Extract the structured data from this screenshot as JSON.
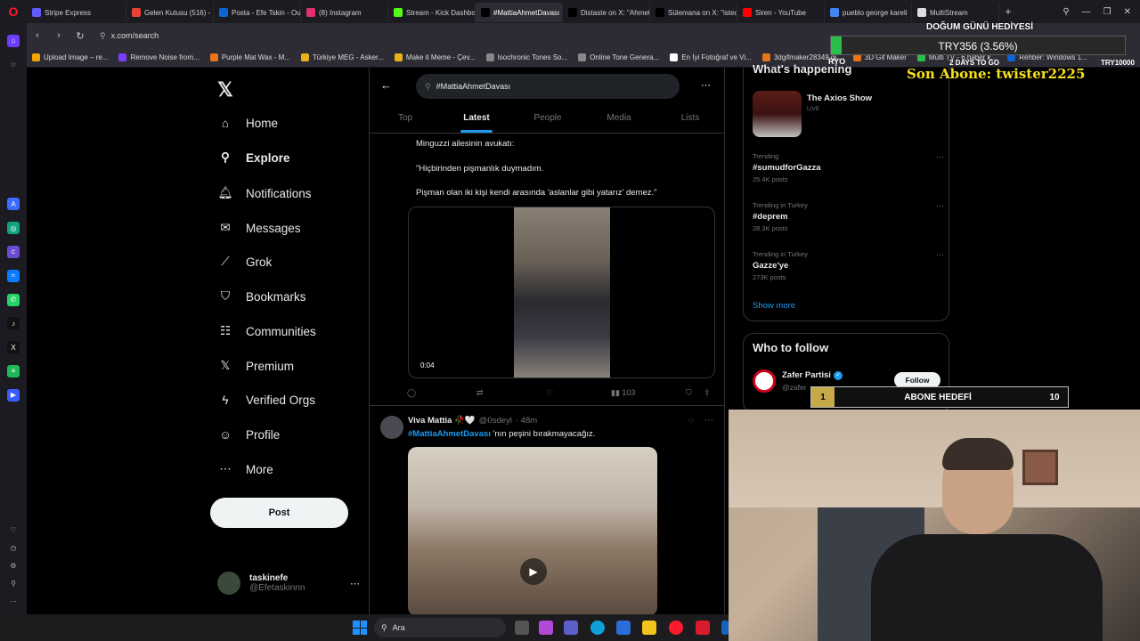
{
  "browser": {
    "tabs": [
      {
        "label": "Stripe Express",
        "color": "#635bff",
        "active": false
      },
      {
        "label": "Gelen Kutusu (516) - ",
        "color": "#ea4335",
        "active": false
      },
      {
        "label": "Posta - Efe Tskin - Ou",
        "color": "#0a64d6",
        "active": false
      },
      {
        "label": "(8) Instagram",
        "color": "#e1306c",
        "active": false
      },
      {
        "label": "Stream - Kick Dashbo",
        "color": "#53fc18",
        "active": false
      },
      {
        "label": "#MattiaAhmetDavası - Se",
        "color": "#000000",
        "active": true
      },
      {
        "label": "Distaste on X: \"Ahmet",
        "color": "#000000",
        "active": false
      },
      {
        "label": "Sülemana on X: \"isted",
        "color": "#000000",
        "active": false
      },
      {
        "label": "Siren - YouTube",
        "color": "#ff0000",
        "active": false
      },
      {
        "label": "pueblo george kareli",
        "color": "#4285f4",
        "active": false
      },
      {
        "label": "MultiStream",
        "color": "#dddddd",
        "active": false
      }
    ],
    "url": "x.com/search",
    "bookmarks": [
      {
        "label": "Upload Image – re...",
        "color": "#f4a300"
      },
      {
        "label": "Remove Noise from...",
        "color": "#7a3cff"
      },
      {
        "label": "Purple Mat Wax - M...",
        "color": "#e8741c"
      },
      {
        "label": "Türkiye MEG - Asker...",
        "color": "#e8b11c"
      },
      {
        "label": "Make it Meme - Çev...",
        "color": "#e8b11c"
      },
      {
        "label": "Isochronic Tones So...",
        "color": "#888888"
      },
      {
        "label": "Online Tone Genera...",
        "color": "#888888"
      },
      {
        "label": "En İyi Fotoğraf ve Vi...",
        "color": "#ffffff"
      },
      {
        "label": "3dgifmaker28349.gi...",
        "color": "#e8741c"
      },
      {
        "label": "3D Gif Maker",
        "color": "#e8741c"
      },
      {
        "label": "Multi TV - 6 haber k...",
        "color": "#2bbd4a"
      },
      {
        "label": "Rehber: Windows 1...",
        "color": "#0a64d6"
      }
    ]
  },
  "x": {
    "nav": [
      {
        "label": "Home",
        "icon": "home-icon",
        "glyph": "⌂",
        "bold": false
      },
      {
        "label": "Explore",
        "icon": "search-icon",
        "glyph": "⚲",
        "bold": true
      },
      {
        "label": "Notifications",
        "icon": "bell-icon",
        "glyph": "🔔︎",
        "bold": false
      },
      {
        "label": "Messages",
        "icon": "mail-icon",
        "glyph": "✉",
        "bold": false
      },
      {
        "label": "Grok",
        "icon": "grok-icon",
        "glyph": "⟋",
        "bold": false
      },
      {
        "label": "Bookmarks",
        "icon": "bookmark-icon",
        "glyph": "⛉",
        "bold": false
      },
      {
        "label": "Communities",
        "icon": "communities-icon",
        "glyph": "☷",
        "bold": false
      },
      {
        "label": "Premium",
        "icon": "x-logo-icon",
        "glyph": "𝕏",
        "bold": false
      },
      {
        "label": "Verified Orgs",
        "icon": "lightning-icon",
        "glyph": "ϟ",
        "bold": false
      },
      {
        "label": "Profile",
        "icon": "person-icon",
        "glyph": "☺",
        "bold": false
      },
      {
        "label": "More",
        "icon": "more-circle-icon",
        "glyph": "⋯",
        "bold": false
      }
    ],
    "post_label": "Post",
    "account": {
      "name": "taskinefe",
      "handle": "@Efetaskinnn"
    },
    "search": {
      "query": "#MattiaAhmetDavası"
    },
    "tabs": [
      "Top",
      "Latest",
      "People",
      "Media",
      "Lists"
    ],
    "active_tab": "Latest",
    "tweet1": {
      "lines": [
        "Minguzzi ailesinin avukatı:",
        "\"Hiçbirinden pişmanlık duymadım.",
        "Pişman olan iki kişi kendi arasında 'aslanlar gibi yatarız' demez.\""
      ],
      "video_time": "0:04",
      "views": "103"
    },
    "tweet2": {
      "name": "Viva Mattia 🥀🤍",
      "handle": "@0sdeyl",
      "time": "· 48m",
      "hashtag": "#MattiaAhmetDavası",
      "text": " 'nın peşini bırakmayacağız."
    },
    "right": {
      "whats_happening": "What's happening",
      "live": {
        "name": "The Axios Show",
        "tag": "LIVE"
      },
      "trends": [
        {
          "context": "Trending",
          "topic": "#sumudforGazza",
          "posts": "25.4K posts"
        },
        {
          "context": "Trending in Turkey",
          "topic": "#deprem",
          "posts": "28.3K posts"
        },
        {
          "context": "Trending in Turkey",
          "topic": "Gazze'ye",
          "posts": "273K posts"
        }
      ],
      "show_more": "Show more",
      "who_to_follow": "Who to follow",
      "suggest": {
        "name": "Zafer Partisi",
        "handle": "@zafer",
        "button": "Follow"
      }
    }
  },
  "overlay": {
    "birthday_title": "DOĞUM GÜNÜ HEDİYESİ",
    "goal_amount": "TRY356 (3.56%)",
    "goal_progress": 0.0356,
    "goal_left": "RYO",
    "days_left": "2 DAYS TO GO",
    "goal_target": "TRY10000",
    "last_sub": "Son Abone: twister2225",
    "sub_goal": {
      "current": "1",
      "label": "ABONE HEDEFİ",
      "target": "10"
    }
  },
  "taskbar": {
    "search_placeholder": "Ara"
  }
}
